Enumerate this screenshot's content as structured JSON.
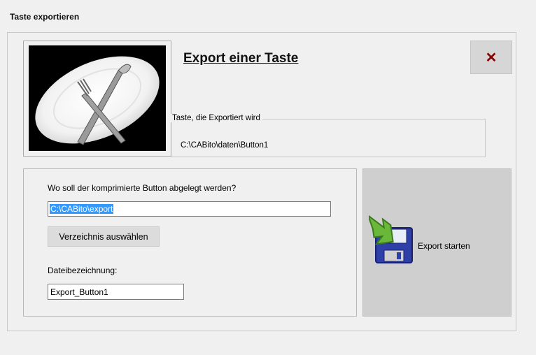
{
  "window": {
    "title": "Taste exportieren"
  },
  "header": {
    "heading": "Export einer Taste",
    "close_icon": "close-x-icon",
    "close_color": "#8b0000"
  },
  "image": {
    "icon": "plate-cutlery-picture"
  },
  "file_group": {
    "legend": "Taste, die Exportiert wird",
    "path": "C:\\CABito\\daten\\Button1"
  },
  "target": {
    "question": "Wo soll der komprimierte Button abgelegt werden?",
    "path_value": "C:\\CABito\\export",
    "choose_dir_label": "Verzeichnis auswählen",
    "filename_label": "Dateibezeichnung:",
    "filename_value": "Export_Button1"
  },
  "export": {
    "label": "Export starten",
    "icon": "save-export-icon"
  },
  "colors": {
    "selection": "#3399ff",
    "button_bg": "#cfcfcf"
  }
}
